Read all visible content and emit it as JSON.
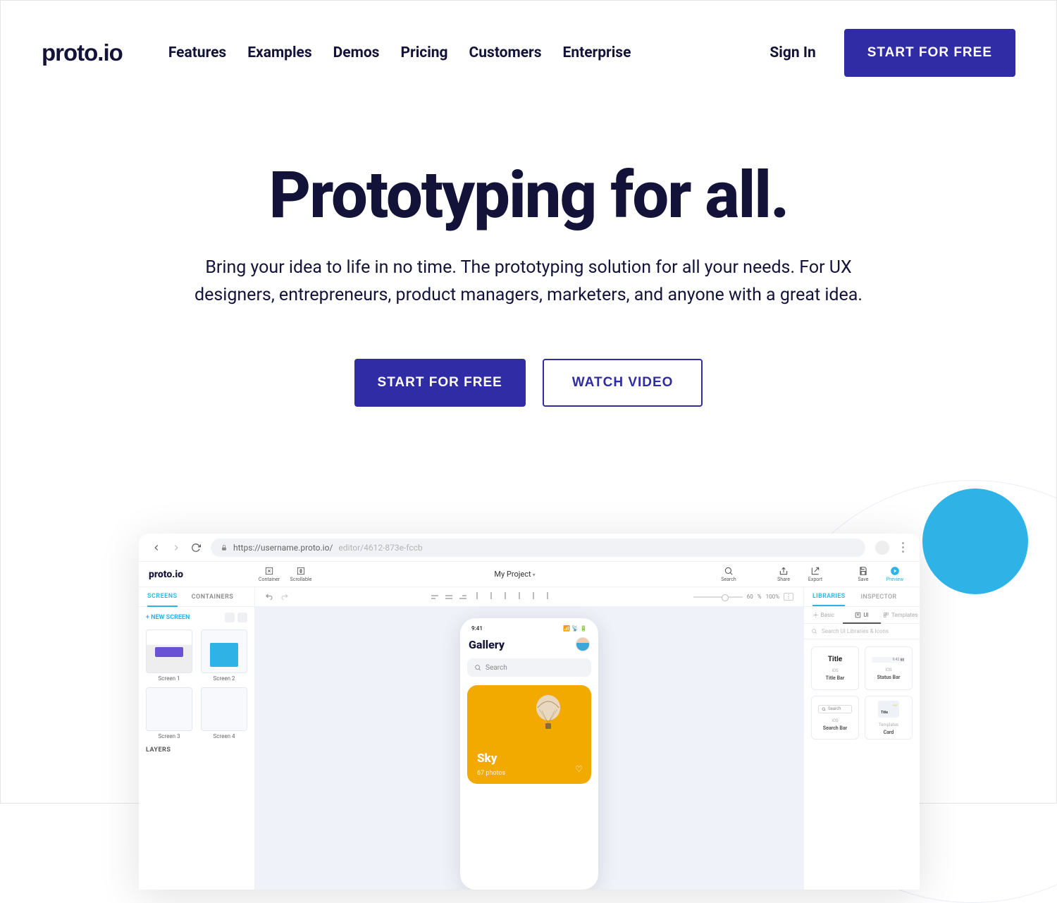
{
  "brand": "proto.io",
  "nav": {
    "items": [
      "Features",
      "Examples",
      "Demos",
      "Pricing",
      "Customers",
      "Enterprise"
    ],
    "signin": "Sign In",
    "cta": "START FOR FREE"
  },
  "hero": {
    "title": "Prototyping for all.",
    "subtitle": "Bring your idea to life in no time. The prototyping solution for all your needs. For UX designers, entrepreneurs, product managers, marketers, and anyone with a great idea.",
    "primary": "START FOR FREE",
    "secondary": "WATCH VIDEO"
  },
  "app": {
    "url_base": "https://username.proto.io/",
    "url_path": "editor/4612-873e-fccb",
    "toolbar": {
      "container": "Container",
      "scrollable": "Scrollable",
      "project": "My Project",
      "search": "Search",
      "share": "Share",
      "export": "Export",
      "save": "Save",
      "preview": "Preview"
    },
    "left_tabs": {
      "screens": "SCREENS",
      "containers": "CONTAINERS"
    },
    "right_tabs": {
      "libraries": "LIBRARIES",
      "inspector": "INSPECTOR"
    },
    "zoom": {
      "opacity": "60",
      "opacity_unit": "%",
      "zoom": "100%"
    },
    "left_panel": {
      "new_screen": "+ NEW SCREEN",
      "screens": [
        "Screen 1",
        "Screen 2",
        "Screen 3",
        "Screen 4"
      ],
      "layers": "LAYERS"
    },
    "phone": {
      "time": "9:41",
      "title": "Gallery",
      "search": "Search",
      "card_title": "Sky",
      "card_sub": "67 photos"
    },
    "libraries": {
      "tabs": {
        "basic": "Basic",
        "ui": "UI",
        "templates": "Templates"
      },
      "search": "Search UI Libraries & Icons",
      "items": [
        {
          "preview": "Title",
          "cat": "iOS",
          "name": "Title Bar"
        },
        {
          "preview_bar": "9:42 ▮▮",
          "cat": "iOS",
          "name": "Status Bar"
        },
        {
          "preview_search": "Search",
          "cat": "iOS",
          "name": "Search Bar"
        },
        {
          "preview_card": true,
          "cat": "Templates",
          "name": "Card"
        }
      ]
    }
  }
}
